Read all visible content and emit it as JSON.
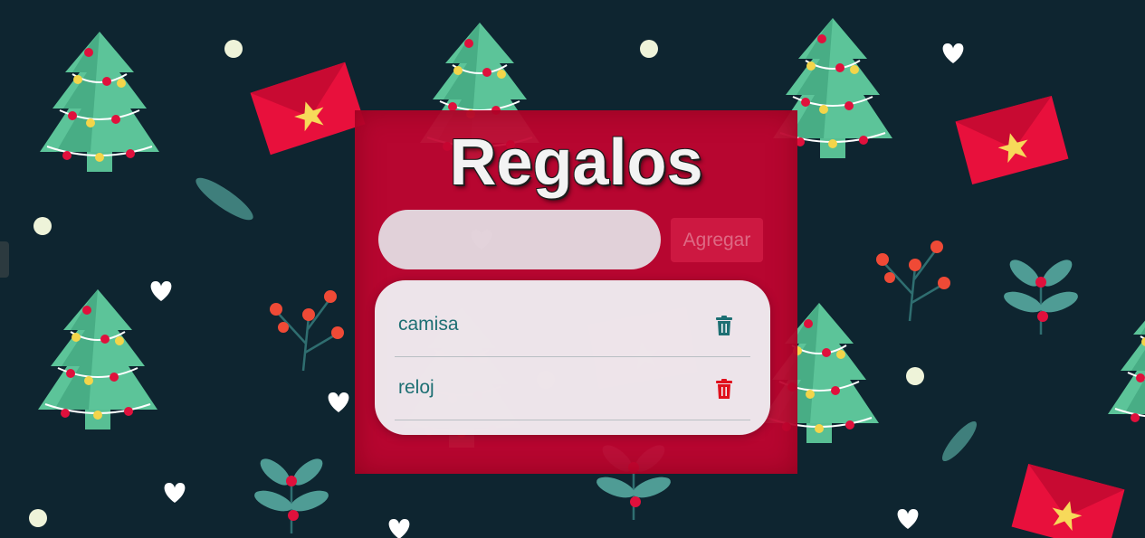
{
  "app": {
    "title": "Regalos"
  },
  "form": {
    "input_value": "",
    "input_placeholder": "",
    "add_label": "Agregar"
  },
  "gifts": [
    {
      "name": "camisa",
      "trash_color": "#1d6f73"
    },
    {
      "name": "reloj",
      "trash_color": "#e0101c"
    }
  ],
  "icons": {
    "delete": "trash-icon"
  },
  "colors": {
    "background": "#0e2530",
    "card": "#c40430",
    "accent_teal": "#1d6f73",
    "accent_red": "#e0101c"
  }
}
